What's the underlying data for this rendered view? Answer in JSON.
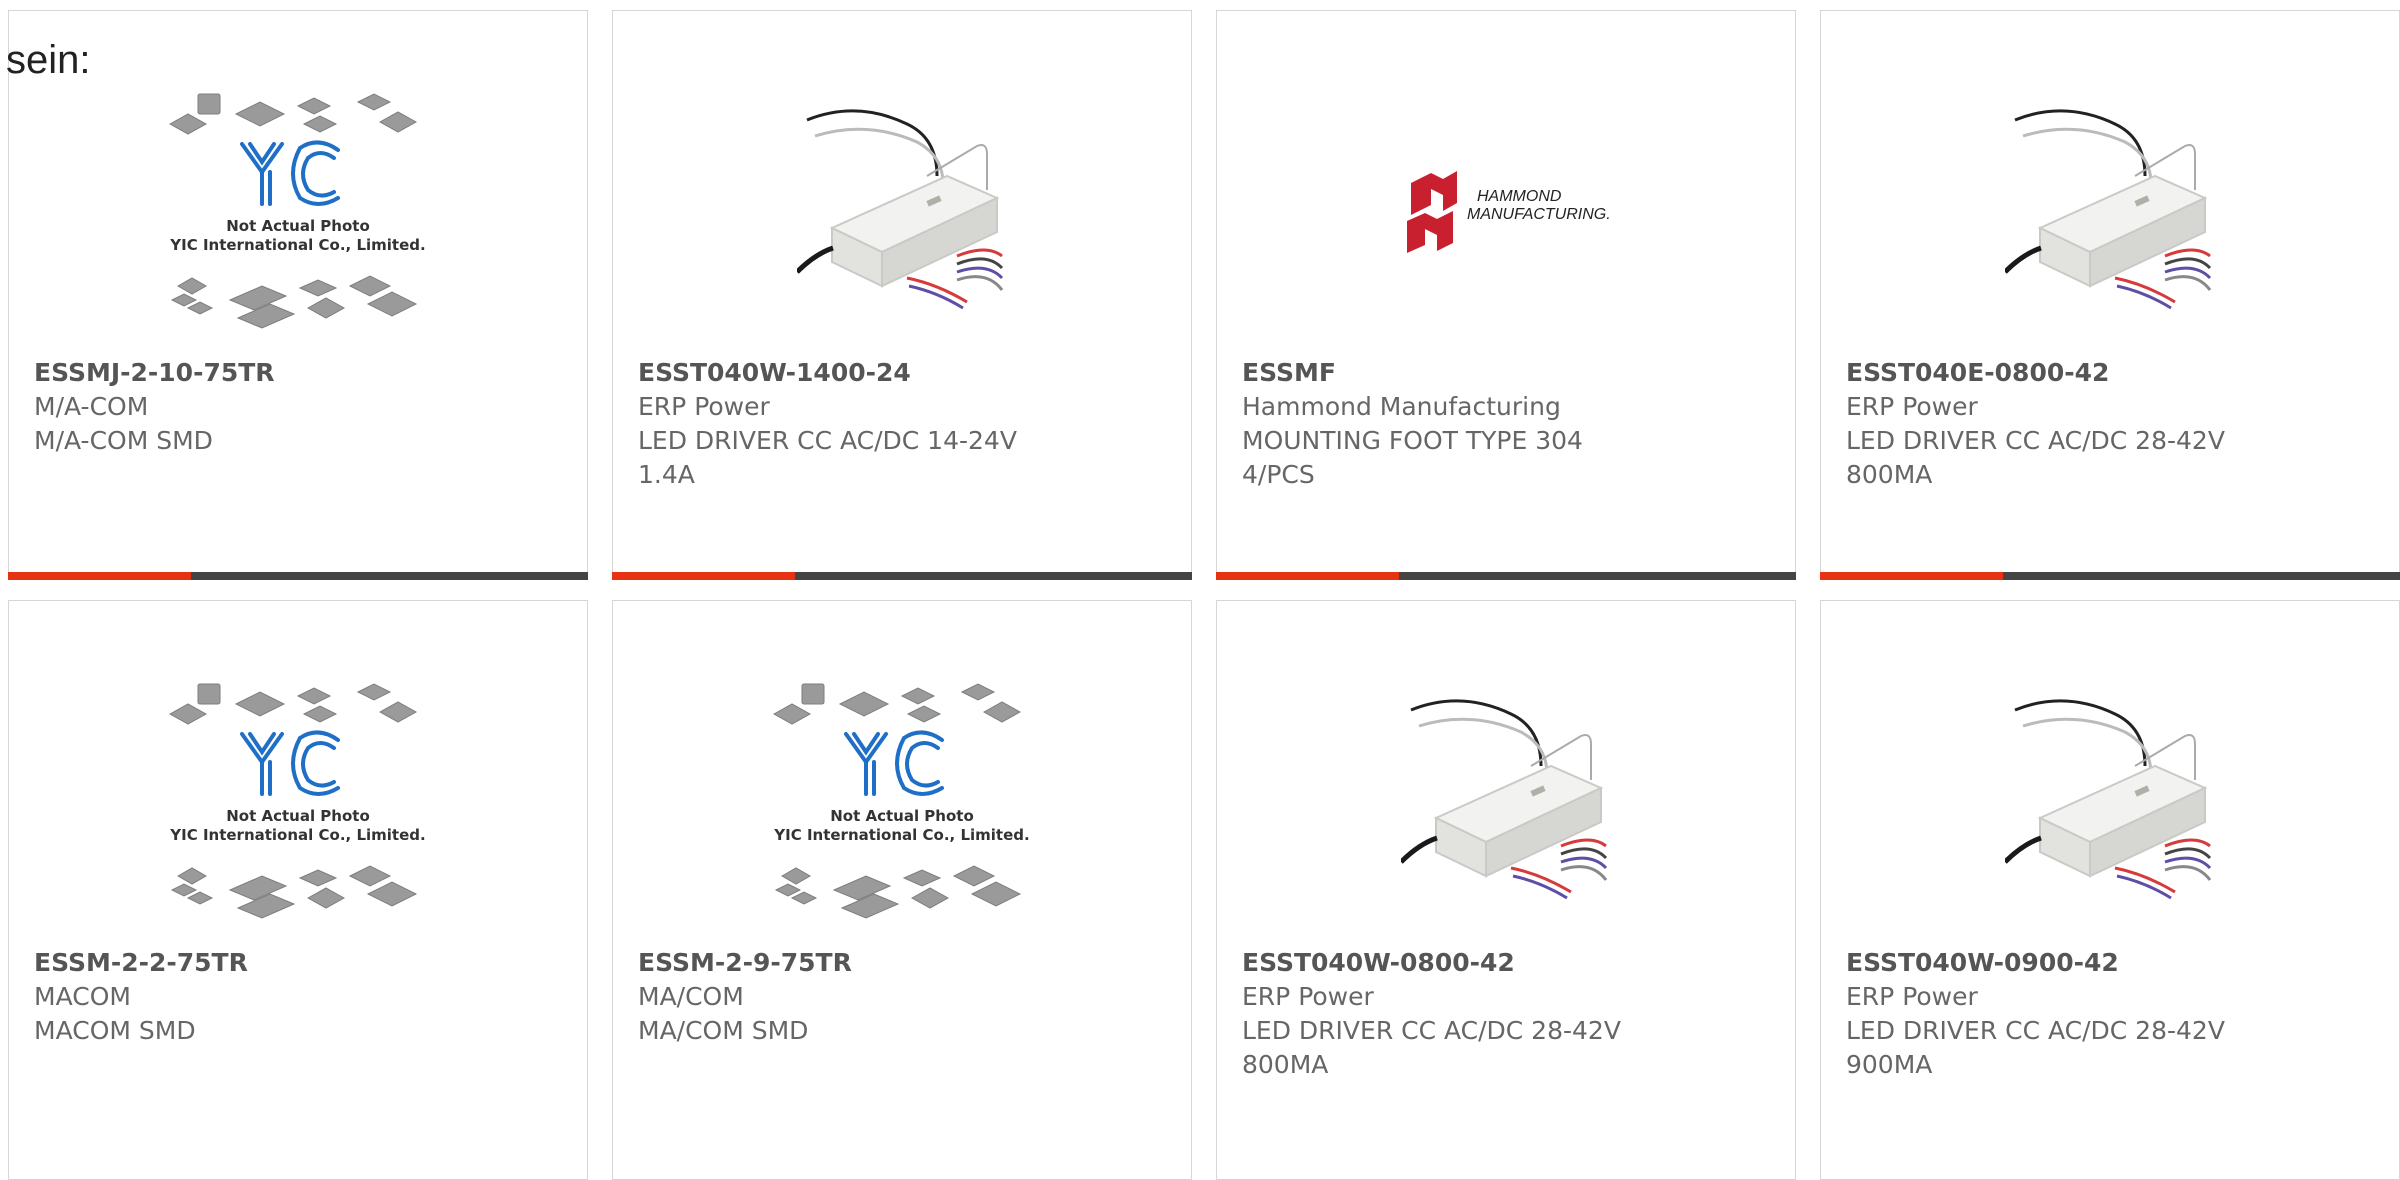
{
  "page": {
    "intro_text": "sein:"
  },
  "placeholder": {
    "logo": "YIC",
    "line1": "Not Actual Photo",
    "line2": "YIC International Co., Limited."
  },
  "hammond_logo": {
    "line1": "HAMMOND",
    "line2": "MANUFACTURING."
  },
  "colors": {
    "accent_bar": "#e63312",
    "dark_bar": "#444444",
    "card_border": "#d6d6d6",
    "yic_blue": "#1f6fc7",
    "hammond_red": "#c8202f"
  },
  "products": [
    {
      "part": "ESSMJ-2-10-75TR",
      "manufacturer": "M/A-COM",
      "description": [
        "M/A-COM SMD"
      ],
      "image": "placeholder"
    },
    {
      "part": "ESST040W-1400-24",
      "manufacturer": "ERP Power",
      "description": [
        "LED DRIVER CC AC/DC 14-24V",
        "1.4A"
      ],
      "image": "led-driver"
    },
    {
      "part": "ESSMF",
      "manufacturer": "Hammond Manufacturing",
      "description": [
        "MOUNTING FOOT TYPE 304",
        "4/PCS"
      ],
      "image": "hammond-logo"
    },
    {
      "part": "ESST040E-0800-42",
      "manufacturer": "ERP Power",
      "description": [
        "LED DRIVER CC AC/DC 28-42V",
        "800MA"
      ],
      "image": "led-driver"
    },
    {
      "part": "ESSM-2-2-75TR",
      "manufacturer": "MACOM",
      "description": [
        "MACOM SMD"
      ],
      "image": "placeholder"
    },
    {
      "part": "ESSM-2-9-75TR",
      "manufacturer": "MA/COM",
      "description": [
        "MA/COM SMD"
      ],
      "image": "placeholder"
    },
    {
      "part": "ESST040W-0800-42",
      "manufacturer": "ERP Power",
      "description": [
        "LED DRIVER CC AC/DC 28-42V",
        "800MA"
      ],
      "image": "led-driver"
    },
    {
      "part": "ESST040W-0900-42",
      "manufacturer": "ERP Power",
      "description": [
        "LED DRIVER CC AC/DC 28-42V",
        "900MA"
      ],
      "image": "led-driver"
    }
  ]
}
